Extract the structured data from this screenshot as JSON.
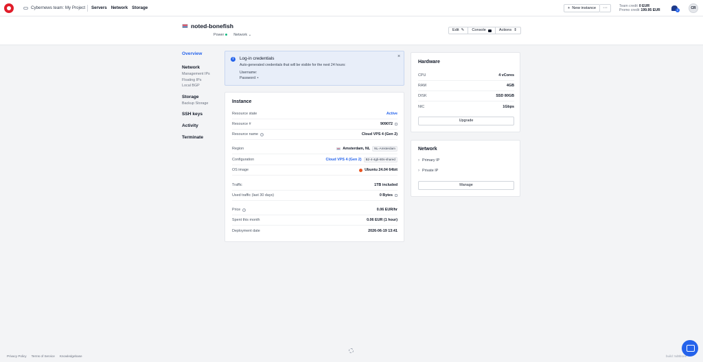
{
  "topbar": {
    "project": "Cybernews team: My Project",
    "nav": [
      "Servers",
      "Network",
      "Storage"
    ],
    "new_instance": "New instance",
    "more": "···",
    "team_credit_label": "Team credit",
    "team_credit_value": "0 EUR",
    "promo_credit_label": "Promo credit",
    "promo_credit_value": "199.95 EUR",
    "notif_count": "2",
    "avatar": "CR"
  },
  "header": {
    "server_name": "noted-bonefish",
    "power_label": "Power",
    "network_label": "Network",
    "edit": "Edit",
    "console": "Console",
    "actions": "Actions"
  },
  "left_nav": {
    "overview": "Overview",
    "network": "Network",
    "network_items": [
      "Management IPs",
      "Floating IPs",
      "Local BGP"
    ],
    "storage": "Storage",
    "storage_items": [
      "Backup Storage"
    ],
    "ssh_keys": "SSH keys",
    "activity": "Activity",
    "terminate": "Terminate"
  },
  "notice": {
    "title": "Log-in credentials",
    "text": "Auto-generated credentials that will be visible for the next 24 hours:",
    "username_label": "Username:",
    "password_label": "Password:",
    "password_value": "•"
  },
  "instance": {
    "title": "Instance",
    "rows": [
      {
        "label": "Resource state",
        "value": "Active"
      },
      {
        "label": "Resource #",
        "value": "909072"
      },
      {
        "label": "Resource name",
        "value": "Cloud VPS 4 (Gen 2)"
      },
      {
        "label": "Region",
        "value": "Amsterdam, NL",
        "tag": "NL-Amsterdam"
      },
      {
        "label": "Configuration",
        "value": "Cloud VPS 4 (Gen 2)",
        "tag": "B2-4-4gb-80s-shared"
      },
      {
        "label": "OS image",
        "value": "Ubuntu 24.04 64bit"
      },
      {
        "label": "Traffic",
        "value": "1TB included"
      },
      {
        "label": "Used traffic (last 30 days)",
        "value": "0 Bytes"
      },
      {
        "label": "Price",
        "value": "0.06 EUR/hr"
      },
      {
        "label": "Spent this month",
        "value": "0.06 EUR (1 hour)"
      },
      {
        "label": "Deployment date",
        "value": "2026-06-19 13:41"
      }
    ]
  },
  "hardware": {
    "title": "Hardware",
    "rows": [
      {
        "label": "CPU",
        "value": "4 vCores"
      },
      {
        "label": "RAM",
        "value": "4GB"
      },
      {
        "label": "DISK",
        "value": "SSD 80GB"
      },
      {
        "label": "NIC",
        "value": "1Gbps"
      }
    ],
    "upgrade": "Upgrade"
  },
  "network_card": {
    "title": "Network",
    "items": [
      "Primary IP",
      "Private IP"
    ],
    "manage": "Manage"
  },
  "footer": {
    "links": [
      "Privacy Policy",
      "Terms of Service",
      "Knowledgebase"
    ],
    "build": "build: 5d8b1ee"
  },
  "colors": {
    "brand_red": "#e11d2a",
    "accent_blue": "#2563eb",
    "status_green": "#10b981"
  }
}
